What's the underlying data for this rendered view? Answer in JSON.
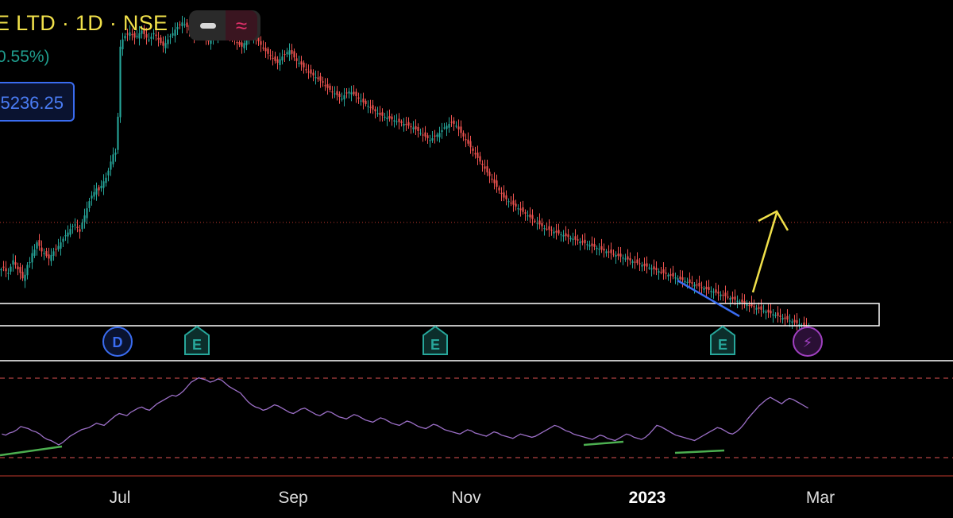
{
  "header": {
    "title": "E LTD · 1D · NSE",
    "change": "0.55%)",
    "price_label": "5236.25"
  },
  "colors": {
    "up": "#26a69a",
    "down": "#ef5350",
    "indicator": "#9c6fc7",
    "support_zone": "#ffffff",
    "trendline_blue": "#3a6cf0",
    "arrow": "#f0e04a",
    "divergence_green": "#4caf50",
    "rsi_bands": "#e05555",
    "earnings_badge": "#27a79b",
    "dividend_badge": "#3a6cf0",
    "flash_badge": "#a040c0"
  },
  "toolbar": {
    "icons": [
      "minus-icon",
      "wave-icon"
    ]
  },
  "events": [
    {
      "type": "dividend",
      "label": "D",
      "icon": "dividend-badge"
    },
    {
      "type": "earnings",
      "label": "E",
      "icon": "earnings-badge"
    },
    {
      "type": "earnings",
      "label": "E",
      "icon": "earnings-badge"
    },
    {
      "type": "earnings",
      "label": "E",
      "icon": "earnings-badge"
    },
    {
      "type": "flash",
      "label": "⚡",
      "icon": "flash-badge"
    }
  ],
  "chart_data": {
    "type": "candlestick",
    "x_ticks": [
      "Jul",
      "Sep",
      "Nov",
      "2023",
      "Mar"
    ],
    "x_tick_emphasis": [
      false,
      false,
      false,
      true,
      false
    ],
    "current_price_line": true,
    "support_zone": true,
    "series": [
      {
        "name": "",
        "type": "candlestick",
        "close_path": [
          300,
          302,
          298,
          296,
          303,
          310,
          305,
          300,
          296,
          290,
          294,
          305,
          308,
          318,
          322,
          330,
          326,
          320,
          318,
          315,
          312,
          316,
          320,
          322,
          326,
          330,
          334,
          338,
          341,
          345,
          348,
          350,
          346,
          342,
          352,
          360,
          368,
          376,
          382,
          386,
          390,
          388,
          393,
          398,
          402,
          410,
          420,
          428,
          430,
          470,
          548,
          556,
          560,
          562,
          564,
          561,
          558,
          560,
          563,
          566,
          562,
          558,
          556,
          559,
          563,
          560,
          556,
          552,
          549,
          552,
          556,
          560,
          563,
          567,
          570,
          572,
          575,
          573,
          570,
          566,
          563,
          560,
          562,
          565,
          568,
          564,
          558,
          554,
          556,
          560,
          562,
          565,
          568,
          572,
          570,
          566,
          562,
          558,
          556,
          552,
          550,
          548,
          552,
          556,
          559,
          562,
          560,
          556,
          554,
          550,
          546,
          543,
          540,
          538,
          535,
          532,
          530,
          534,
          537,
          539,
          542,
          544,
          540,
          536,
          532,
          530,
          528,
          525,
          522,
          520,
          518,
          516,
          514,
          512,
          510,
          508,
          505,
          502,
          500,
          498,
          496,
          494,
          492,
          490,
          494,
          496,
          498,
          497,
          495,
          493,
          490,
          488,
          486,
          484,
          482,
          480,
          478,
          476,
          474,
          472,
          471,
          470,
          469,
          468,
          467,
          466,
          465,
          464,
          463,
          462,
          461,
          460,
          459,
          458,
          456,
          454,
          452,
          450,
          448,
          446,
          444,
          446,
          448,
          450,
          452,
          455,
          458,
          460,
          462,
          464,
          462,
          460,
          456,
          452,
          448,
          444,
          440,
          436,
          432,
          428,
          424,
          420,
          416,
          412,
          408,
          404,
          400,
          396,
          392,
          388,
          384,
          380,
          378,
          376,
          374,
          372,
          370,
          368,
          366,
          364,
          362,
          360,
          358,
          356,
          354,
          352,
          350,
          348,
          346,
          345,
          344,
          343,
          342,
          341,
          340,
          339,
          338,
          337,
          336,
          335,
          334,
          333,
          332,
          331,
          330,
          329,
          328,
          327,
          326,
          325,
          324,
          323,
          322,
          321,
          320,
          319,
          318,
          317,
          316,
          315,
          314,
          313,
          312,
          311,
          310,
          309,
          308,
          307,
          306,
          305,
          304,
          303,
          302,
          301,
          300,
          299,
          298,
          297,
          296,
          295,
          294,
          293,
          292,
          291,
          290,
          289,
          288,
          287,
          286,
          285,
          284,
          283,
          282,
          281,
          280,
          279,
          278,
          277,
          276,
          275,
          274,
          273,
          272,
          271,
          270,
          269,
          268,
          267,
          266,
          265,
          264,
          263,
          262,
          261,
          260,
          259,
          258,
          257,
          256,
          255,
          254,
          253,
          252,
          251,
          250,
          249,
          248,
          247,
          246,
          245,
          244,
          243,
          242,
          241,
          240,
          239,
          238,
          237,
          236,
          235
        ]
      }
    ],
    "indicator": {
      "name": "",
      "type": "oscillator",
      "values": [
        38,
        37,
        39,
        40,
        42,
        45,
        44,
        43,
        41,
        40,
        38,
        35,
        33,
        32,
        30,
        28,
        30,
        33,
        36,
        38,
        40,
        42,
        43,
        44,
        46,
        48,
        47,
        46,
        49,
        52,
        55,
        57,
        56,
        55,
        58,
        60,
        62,
        63,
        61,
        60,
        63,
        66,
        68,
        70,
        72,
        74,
        73,
        75,
        78,
        82,
        86,
        88,
        90,
        89,
        88,
        86,
        87,
        89,
        88,
        85,
        82,
        80,
        78,
        76,
        72,
        68,
        65,
        63,
        62,
        60,
        61,
        63,
        65,
        64,
        62,
        60,
        58,
        57,
        59,
        61,
        62,
        60,
        58,
        56,
        55,
        57,
        59,
        58,
        56,
        54,
        53,
        52,
        54,
        56,
        55,
        53,
        51,
        50,
        49,
        51,
        53,
        52,
        50,
        48,
        47,
        46,
        48,
        50,
        49,
        47,
        45,
        44,
        43,
        45,
        47,
        46,
        44,
        42,
        41,
        40,
        39,
        38,
        40,
        42,
        41,
        39,
        38,
        37,
        36,
        38,
        40,
        39,
        37,
        36,
        35,
        34,
        36,
        38,
        37,
        36,
        35,
        36,
        38,
        40,
        42,
        44,
        46,
        45,
        43,
        41,
        40,
        38,
        37,
        36,
        35,
        34,
        33,
        35,
        37,
        36,
        34,
        33,
        32,
        34,
        36,
        38,
        37,
        35,
        34,
        33,
        35,
        38,
        42,
        46,
        45,
        43,
        41,
        39,
        37,
        36,
        35,
        34,
        33,
        32,
        34,
        36,
        38,
        40,
        42,
        44,
        43,
        41,
        39,
        38,
        40,
        43,
        47,
        52,
        56,
        60,
        64,
        67,
        70,
        72,
        70,
        68,
        66,
        69,
        71,
        70,
        68,
        66,
        64,
        62
      ]
    },
    "indicator_bands": true
  }
}
